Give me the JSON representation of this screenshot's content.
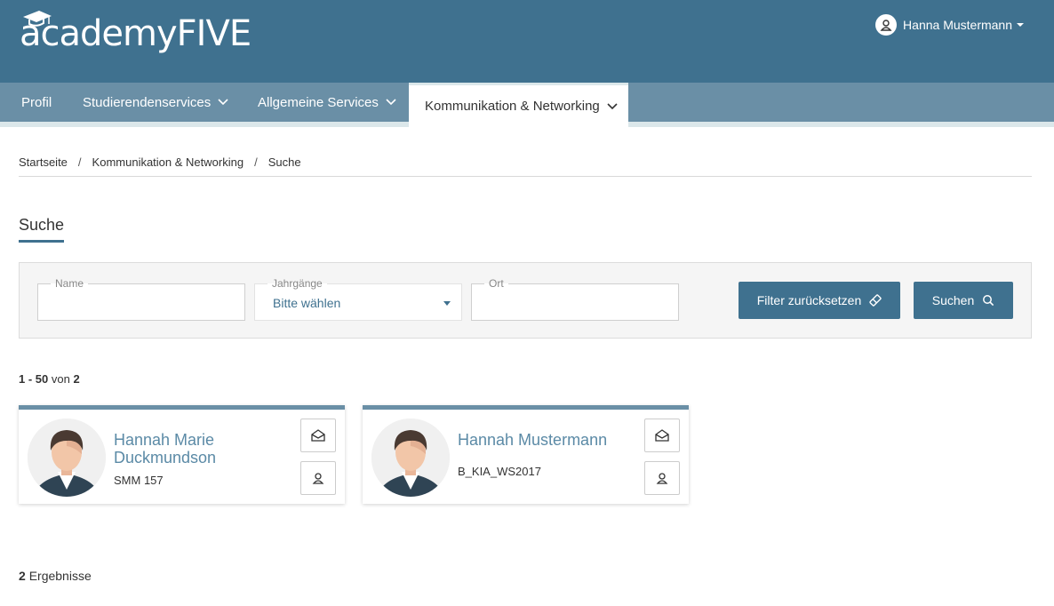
{
  "app": {
    "logo_text": "academyFIVE"
  },
  "user": {
    "name": "Hanna Mustermann"
  },
  "nav": {
    "items": [
      {
        "label": "Profil"
      },
      {
        "label": "Studierendenservices"
      },
      {
        "label": "Allgemeine Services"
      },
      {
        "label": "Kommunikation & Networking"
      }
    ]
  },
  "breadcrumb": {
    "items": [
      "Startseite",
      "Kommunikation & Networking",
      "Suche"
    ],
    "separator": "/"
  },
  "page": {
    "title": "Suche"
  },
  "filters": {
    "name": {
      "label": "Name",
      "value": ""
    },
    "jahrgaenge": {
      "label": "Jahrgänge",
      "value": "Bitte wählen"
    },
    "ort": {
      "label": "Ort",
      "value": ""
    },
    "reset_label": "Filter zurücksetzen",
    "search_label": "Suchen"
  },
  "pagination": {
    "range": "1 - 50",
    "of_word": "von",
    "total": "2"
  },
  "cards": [
    {
      "name": "Hannah Marie Duckmundson",
      "sub": "SMM 157"
    },
    {
      "name": "Hannah Mustermann",
      "sub": "B_KIA_WS2017"
    }
  ],
  "results": {
    "count": "2",
    "label": "Ergebnisse"
  },
  "colors": {
    "primary": "#3f718f",
    "nav": "#6a8fa6",
    "link": "#5b8aa6"
  },
  "icons": [
    "graduation-cap-icon",
    "user-icon",
    "chevron-down-icon",
    "eraser-icon",
    "search-icon",
    "envelope-open-icon"
  ]
}
